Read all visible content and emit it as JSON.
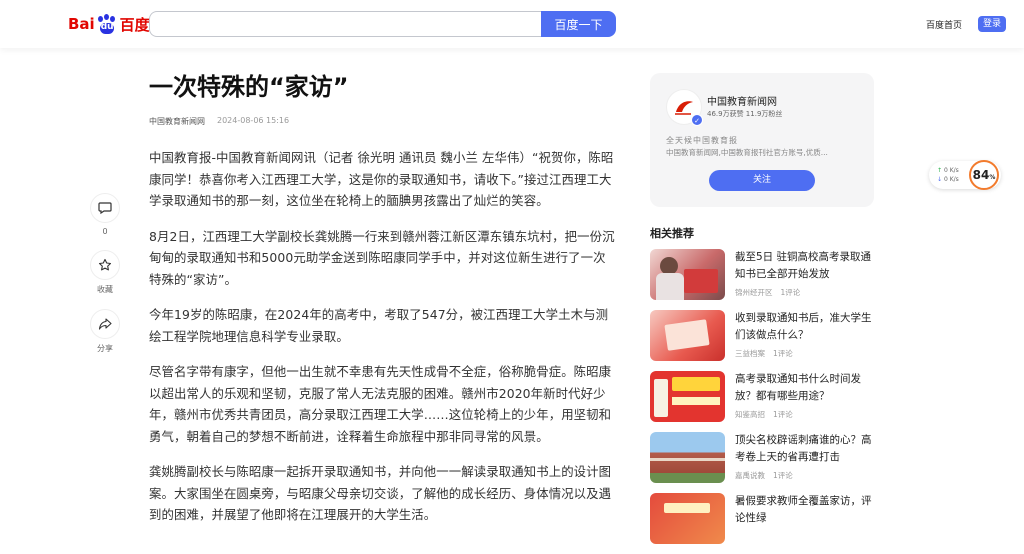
{
  "header": {
    "logo_bai": "Bai",
    "logo_du": "du",
    "logo_cn": "百度",
    "search_value": "",
    "search_button": "百度一下",
    "home_link": "百度首页",
    "login_button": "登录"
  },
  "actions": {
    "comment_count": "0",
    "collect_label": "收藏",
    "share_label": "分享"
  },
  "article": {
    "title": "一次特殊的“家访”",
    "source": "中国教育新闻网",
    "date": "2024-08-06 15:16",
    "paragraphs": [
      "中国教育报-中国教育新闻网讯（记者 徐光明 通讯员 魏小兰 左华伟）“祝贺你，陈昭康同学！恭喜你考入江西理工大学，这是你的录取通知书，请收下。”接过江西理工大学录取通知书的那一刻，这位坐在轮椅上的腼腆男孩露出了灿烂的笑容。",
      "8月2日，江西理工大学副校长龚姚腾一行来到赣州蓉江新区潭东镇东坑村，把一份沉甸甸的录取通知书和5000元助学金送到陈昭康同学手中，并对这位新生进行了一次特殊的“家访”。",
      "今年19岁的陈昭康，在2024年的高考中，考取了547分，被江西理工大学土木与测绘工程学院地理信息科学专业录取。",
      "尽管名字带有康字，但他一出生就不幸患有先天性成骨不全症，俗称脆骨症。陈昭康以超出常人的乐观和坚韧，克服了常人无法克服的困难。赣州市2020年新时代好少年，赣州市优秀共青团员，高分录取江西理工大学……这位轮椅上的少年，用坚韧和勇气，朝着自己的梦想不断前进，诠释着生命旅程中那非同寻常的风景。",
      "龚姚腾副校长与陈昭康一起拆开录取通知书，并向他一一解读录取通知书上的设计图案。大家围坐在圆桌旁，与昭康父母亲切交谈，了解他的成长经历、身体情况以及遇到的困难，并展望了他即将在江理展开的大学生活。"
    ]
  },
  "author_card": {
    "name": "中国教育新闻网",
    "stats": "46.9万获赞 11.9万粉丝",
    "desc1": "全天候中国教育报",
    "desc2": "中国教育新闻网,中国教育报刊社官方账号,优质...",
    "follow_button": "关注"
  },
  "related": {
    "heading": "相关推荐",
    "items": [
      {
        "title": "截至5日 驻铜高校高考录取通知书已全部开始发放",
        "source": "锦州经开区",
        "comments": "1评论"
      },
      {
        "title": "收到录取通知书后，准大学生们该做点什么？",
        "source": "三益档案",
        "comments": "1评论"
      },
      {
        "title": "高考录取通知书什么时间发放？都有哪些用途？",
        "source": "知鉴高招",
        "comments": "1评论"
      },
      {
        "title": "顶尖名校辟谣刺痛谁的心？高考卷上天的省再遭打击",
        "source": "嘉禹说教",
        "comments": "1评论"
      },
      {
        "title": "暑假要求教师全覆盖家访，评论性绿",
        "source": "",
        "comments": ""
      }
    ]
  },
  "speed_widget": {
    "up": "0",
    "up_unit": "K/s",
    "down": "0",
    "down_unit": "K/s",
    "score": "84",
    "score_unit": "%"
  },
  "colors": {
    "brand_blue": "#4e6ef2",
    "brand_red": "#e10601",
    "accent_orange": "#f27b2d"
  }
}
